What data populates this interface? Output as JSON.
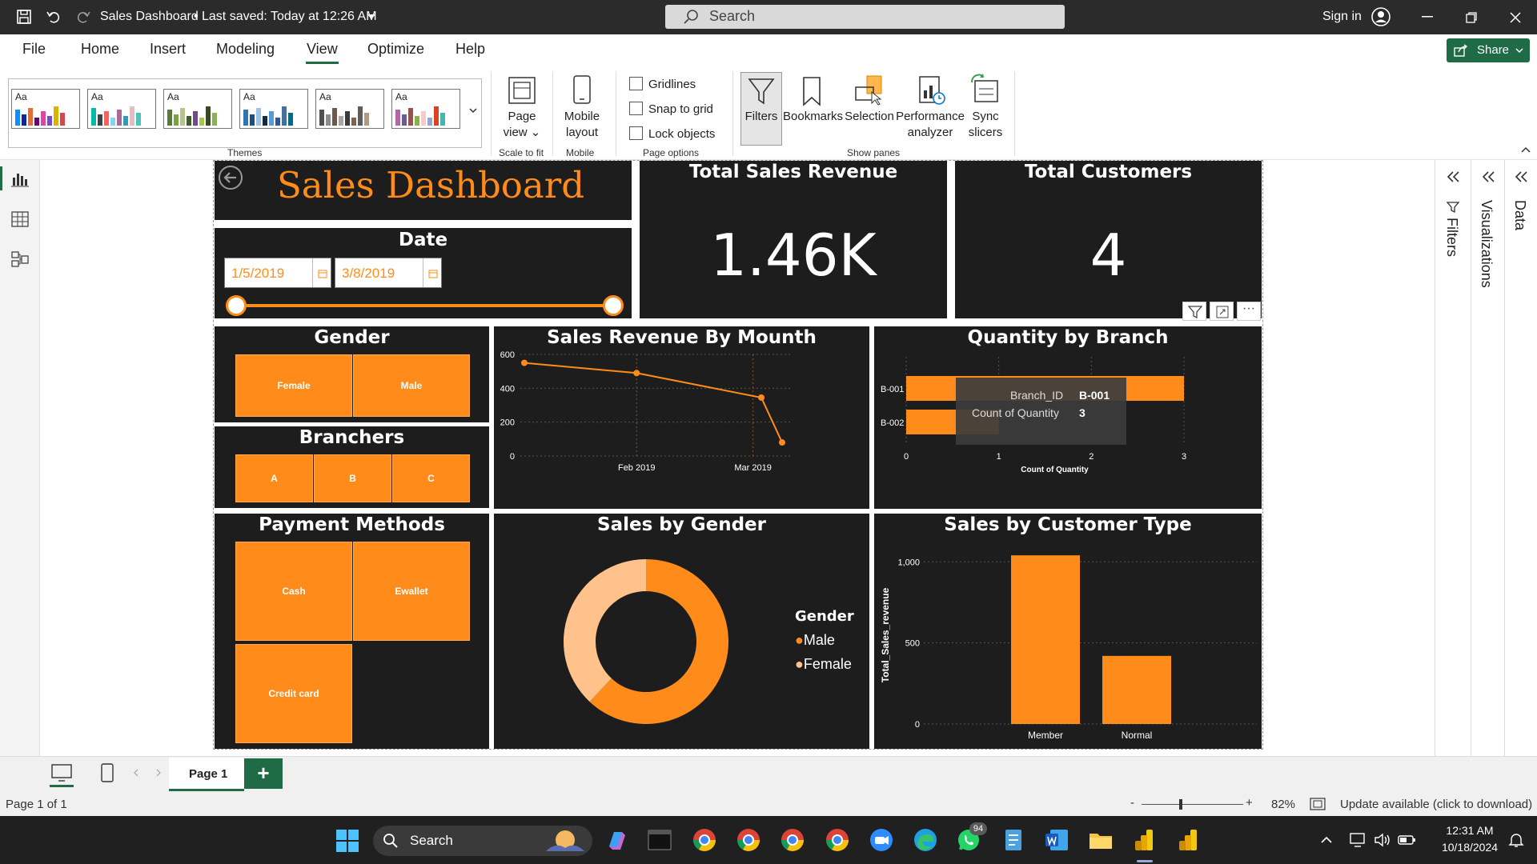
{
  "window": {
    "title": "Sales Dashboard",
    "saved_status": "Last saved: Today at 12:26 AM",
    "search_placeholder": "Search",
    "sign_in": "Sign in"
  },
  "menu": {
    "items": [
      "File",
      "Home",
      "Insert",
      "Modeling",
      "View",
      "Optimize",
      "Help"
    ],
    "active": "View",
    "share": "Share"
  },
  "ribbon": {
    "themes_label": "Themes",
    "theme_aa": "Aa",
    "page_view": [
      "Page",
      "view"
    ],
    "scale_to_fit": "Scale to fit",
    "mobile_layout": [
      "Mobile",
      "layout"
    ],
    "mobile": "Mobile",
    "gridlines": "Gridlines",
    "snap_to_grid": "Snap to grid",
    "lock_objects": "Lock objects",
    "page_options": "Page options",
    "filters": "Filters",
    "bookmarks": "Bookmarks",
    "selection": "Selection",
    "performance_analyzer": [
      "Performance",
      "analyzer"
    ],
    "sync_slicers": [
      "Sync",
      "slicers"
    ],
    "show_panes": "Show panes"
  },
  "panes": {
    "filters": "Filters",
    "visualizations": "Visualizations",
    "data": "Data"
  },
  "dashboard": {
    "title": "Sales Dashboard",
    "date_title": "Date",
    "date_start": "1/5/2019",
    "date_end": "3/8/2019",
    "total_sales_title": "Total Sales Revenue",
    "total_sales_value": "1.46K",
    "total_customers_title": "Total Customers",
    "total_customers_value": "4",
    "gender_title": "Gender",
    "gender_buttons": [
      "Female",
      "Male"
    ],
    "branches_title": "Branchers",
    "branch_buttons": [
      "A",
      "B",
      "C"
    ],
    "payment_title": "Payment Methods",
    "payment_buttons": [
      "Cash",
      "Ewallet",
      "Credit card"
    ],
    "line_title": "Sales Revenue By Mounth",
    "branch_chart_title": "Quantity by Branch",
    "donut_title": "Sales by Gender",
    "custtype_title": "Sales by Customer Type",
    "tooltip": {
      "k1": "Branch_ID",
      "v1": "B-001",
      "k2": "Count of Quantity",
      "v2": "3"
    }
  },
  "chart_data": [
    {
      "type": "line",
      "title": "Sales Revenue By Mounth",
      "x_tick_labels": [
        "Feb 2019",
        "Mar 2019"
      ],
      "y_ticks": [
        "600",
        "400",
        "200",
        "0"
      ],
      "ylim": [
        0,
        600
      ],
      "points": [
        {
          "x": "2019-01-05",
          "y": 550
        },
        {
          "x": "2019-02-01",
          "y": 490
        },
        {
          "x": "2019-03-03",
          "y": 345
        },
        {
          "x": "2019-03-08",
          "y": 80
        }
      ],
      "color": "#ff8c1a"
    },
    {
      "type": "bar",
      "orientation": "horizontal",
      "title": "Quantity by Branch",
      "categories": [
        "B-001",
        "B-002"
      ],
      "values": [
        3,
        1
      ],
      "xlabel": "Count of Quantity",
      "x_ticks": [
        "0",
        "1",
        "2",
        "3"
      ],
      "xlim": [
        0,
        3
      ],
      "color": "#ff8c1a"
    },
    {
      "type": "pie",
      "title": "Sales by Gender",
      "legend_title": "Gender",
      "series": [
        {
          "name": "Male",
          "value": 62,
          "color": "#ff8c1a"
        },
        {
          "name": "Female",
          "value": 38,
          "color": "#ffc28a"
        }
      ]
    },
    {
      "type": "bar",
      "title": "Sales by Customer Type",
      "categories": [
        "Member",
        "Normal"
      ],
      "values": [
        1040,
        420
      ],
      "ylabel": "Total_Sales_revenue",
      "y_ticks": [
        "1,000",
        "500",
        "0"
      ],
      "ylim": [
        0,
        1100
      ],
      "color": "#ff8c1a"
    }
  ],
  "pagebar": {
    "tab": "Page 1",
    "add": "+"
  },
  "status": {
    "page": "Page 1 of 1",
    "zoom": "82%",
    "update": "Update available (click to download)",
    "minus": "-",
    "plus": "+"
  },
  "taskbar": {
    "search": "Search",
    "time": "12:31 AM",
    "date": "10/18/2024",
    "badge": "94"
  }
}
